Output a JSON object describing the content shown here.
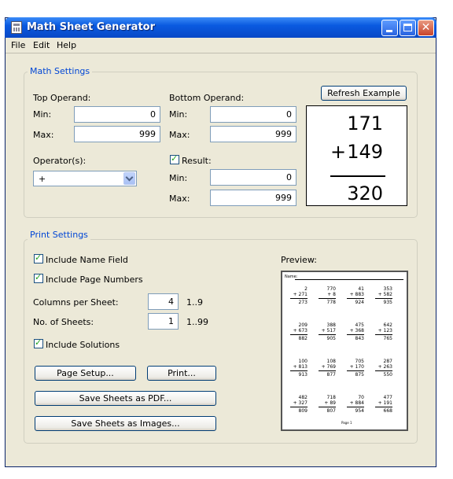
{
  "window": {
    "title": "Math Sheet Generator"
  },
  "menu": {
    "file": "File",
    "edit": "Edit",
    "help": "Help"
  },
  "math_settings": {
    "title": "Math Settings",
    "top_operand": {
      "label": "Top Operand:",
      "min_label": "Min:",
      "min": "0",
      "max_label": "Max:",
      "max": "999"
    },
    "bottom_operand": {
      "label": "Bottom Operand:",
      "min_label": "Min:",
      "min": "0",
      "max_label": "Max:",
      "max": "999"
    },
    "operators": {
      "label": "Operator(s):",
      "selected": "+"
    },
    "result": {
      "label": "Result:",
      "checked": true,
      "min_label": "Min:",
      "min": "0",
      "max_label": "Max:",
      "max": "999"
    },
    "refresh_button": "Refresh Example",
    "example": {
      "top": "171",
      "operator": "+",
      "bottom": "149",
      "result": "320"
    }
  },
  "print_settings": {
    "title": "Print Settings",
    "include_name_field": "Include Name Field",
    "include_page_numbers": "Include Page Numbers",
    "columns_label": "Columns per Sheet:",
    "columns_value": "4",
    "columns_range": "1..9",
    "sheets_label": "No. of Sheets:",
    "sheets_value": "1",
    "sheets_range": "1..99",
    "include_solutions": "Include Solutions",
    "page_setup_button": "Page Setup...",
    "print_button": "Print...",
    "save_pdf_button": "Save Sheets as PDF...",
    "save_images_button": "Save Sheets as Images...",
    "preview_label": "Preview:"
  },
  "preview": {
    "name_label": "Name:",
    "page_label": "Page 1",
    "rows": [
      [
        [
          "2",
          "+ 271",
          "273"
        ],
        [
          "770",
          "+ 8",
          "778"
        ],
        [
          "41",
          "+ 883",
          "924"
        ],
        [
          "353",
          "+ 582",
          "935"
        ]
      ],
      [
        [
          "209",
          "+ 673",
          "882"
        ],
        [
          "388",
          "+ 517",
          "905"
        ],
        [
          "475",
          "+ 368",
          "843"
        ],
        [
          "642",
          "+ 123",
          "765"
        ]
      ],
      [
        [
          "100",
          "+ 813",
          "913"
        ],
        [
          "108",
          "+ 769",
          "877"
        ],
        [
          "705",
          "+ 170",
          "875"
        ],
        [
          "287",
          "+ 263",
          "550"
        ]
      ],
      [
        [
          "482",
          "+ 327",
          "809"
        ],
        [
          "718",
          "+ 89",
          "807"
        ],
        [
          "70",
          "+ 884",
          "954"
        ],
        [
          "477",
          "+ 191",
          "668"
        ]
      ]
    ]
  }
}
